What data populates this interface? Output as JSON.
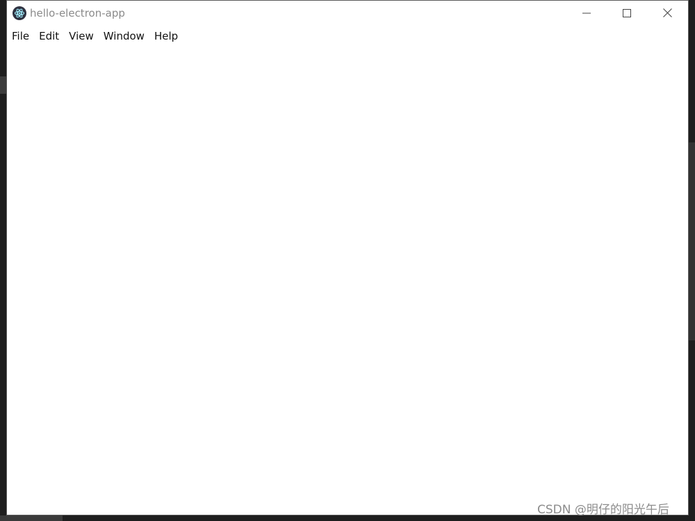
{
  "window": {
    "title": "hello-electron-app",
    "app_icon": "electron-atom-icon",
    "controls": {
      "minimize_icon": "minimize-icon",
      "maximize_icon": "maximize-icon",
      "close_icon": "close-icon"
    }
  },
  "menubar": {
    "items": [
      {
        "label": "File"
      },
      {
        "label": "Edit"
      },
      {
        "label": "View"
      },
      {
        "label": "Window"
      },
      {
        "label": "Help"
      }
    ]
  },
  "watermark": {
    "text": "CSDN @明仔的阳光午后"
  },
  "colors": {
    "window_bg": "#ffffff",
    "title_text": "#8a8a8a",
    "menu_text": "#111111",
    "desktop_bg": "#1e1e1e"
  }
}
